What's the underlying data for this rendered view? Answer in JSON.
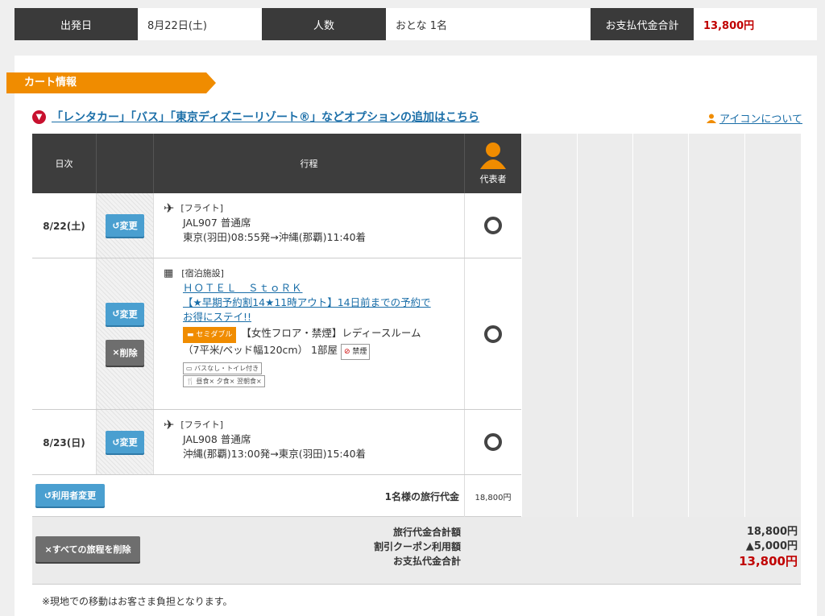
{
  "summary": {
    "departure_label": "出発日",
    "departure_value": "8月22日(土)",
    "people_label": "人数",
    "people_value": "おとな 1名",
    "total_label": "お支払代金合計",
    "total_value": "13,800円"
  },
  "cart": {
    "title": "カート情報",
    "option_link": "「レンタカー」「バス」「東京ディズニーリゾート®」などオプションの追加はこちら",
    "icon_about": "アイコンについて"
  },
  "table": {
    "headers": {
      "day": "日次",
      "itinerary": "行程",
      "representative": "代表者"
    },
    "rows": [
      {
        "date": "8/22(土)",
        "change_label": "変更",
        "category": "[フライト]",
        "line1": "JAL907 普通席",
        "line2": "東京(羽田)08:55発→沖縄(那覇)11:40着"
      },
      {
        "change_label": "変更",
        "delete_label": "削除",
        "category": "[宿泊施設]",
        "hotel_name": "ＨＯＴＥＬ　ＳｔｏＲＫ",
        "plan_line1": "【★早期予約割14★11時アウト】14日前までの予約で",
        "plan_line2": "お得にステイ!!",
        "room_badge": "セミダブル",
        "room_line1": "【女性フロア・禁煙】レディースルーム",
        "room_line2": "（7平米/ベッド幅120cm） 1部屋",
        "smoking": "禁煙",
        "bath": "バスなし・トイレ付き",
        "meals": "昼食×  夕食×  翌朝食×"
      },
      {
        "date": "8/23(日)",
        "change_label": "変更",
        "category": "[フライト]",
        "line1": "JAL908 普通席",
        "line2": "沖縄(那覇)13:00発→東京(羽田)15:40着"
      }
    ],
    "user_change": "利用者変更",
    "per_person_label": "1名様の旅行代金",
    "per_person_value": "18,800円"
  },
  "totals": {
    "delete_all": "すべての旅程を削除",
    "travel_total_label": "旅行代金合計額",
    "travel_total_value": "18,800円",
    "coupon_label": "割引クーポン利用額",
    "coupon_value": "▲5,000円",
    "payment_label": "お支払代金合計",
    "payment_value": "13,800円"
  },
  "note": "※現地での移動はお客さま負担となります。",
  "colors": {
    "accent": "#f08c00",
    "link": "#1a6ea8",
    "price_red": "#c00000",
    "header_dark": "#3d3d3d",
    "change_btn": "#4a9fd0"
  }
}
